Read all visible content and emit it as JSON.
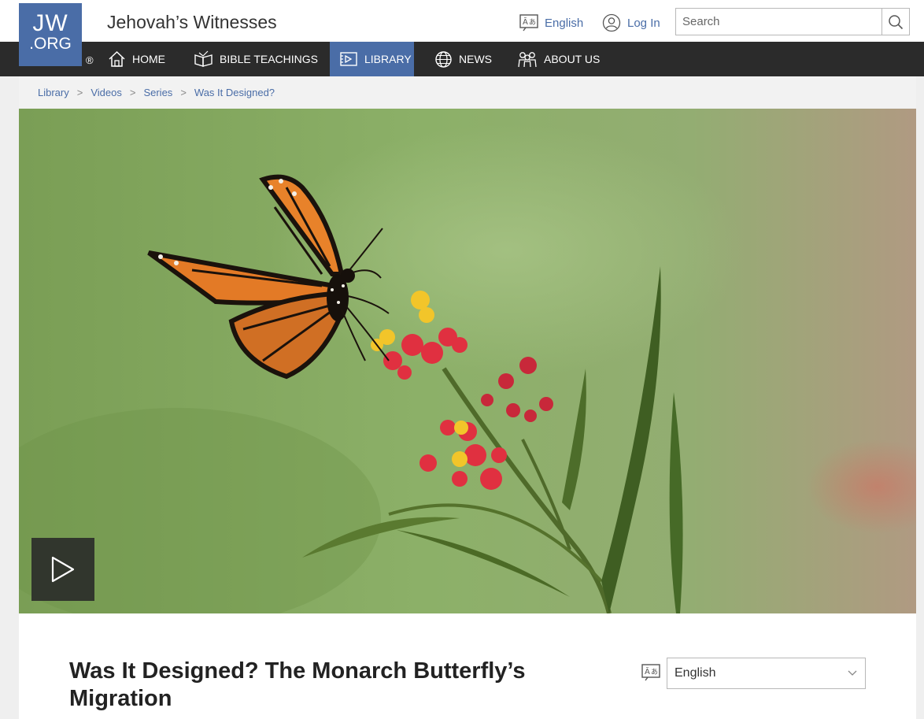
{
  "header": {
    "logo_line1": "JW",
    "logo_line2": ".ORG",
    "registered_mark": "®",
    "site_title": "Jehovah’s Witnesses",
    "language_link": "English",
    "login_link": "Log In",
    "search_placeholder": "Search"
  },
  "nav": {
    "items": [
      {
        "label": "Home",
        "icon": "house-icon",
        "active": false
      },
      {
        "label": "Bible Teachings",
        "icon": "open-bible-icon",
        "active": false
      },
      {
        "label": "Library",
        "icon": "media-library-icon",
        "active": true
      },
      {
        "label": "News",
        "icon": "globe-icon",
        "active": false
      },
      {
        "label": "About Us",
        "icon": "people-icon",
        "active": false
      }
    ]
  },
  "breadcrumb": [
    "Library",
    "Videos",
    "Series",
    "Was It Designed?"
  ],
  "video": {
    "title": "Was It Designed? The Monarch Butterfly’s Migration"
  },
  "language_select": {
    "selected": "English"
  },
  "colors": {
    "brand_blue": "#4a6da7",
    "nav_dark": "#2b2b2b",
    "link": "#4a6da7"
  }
}
